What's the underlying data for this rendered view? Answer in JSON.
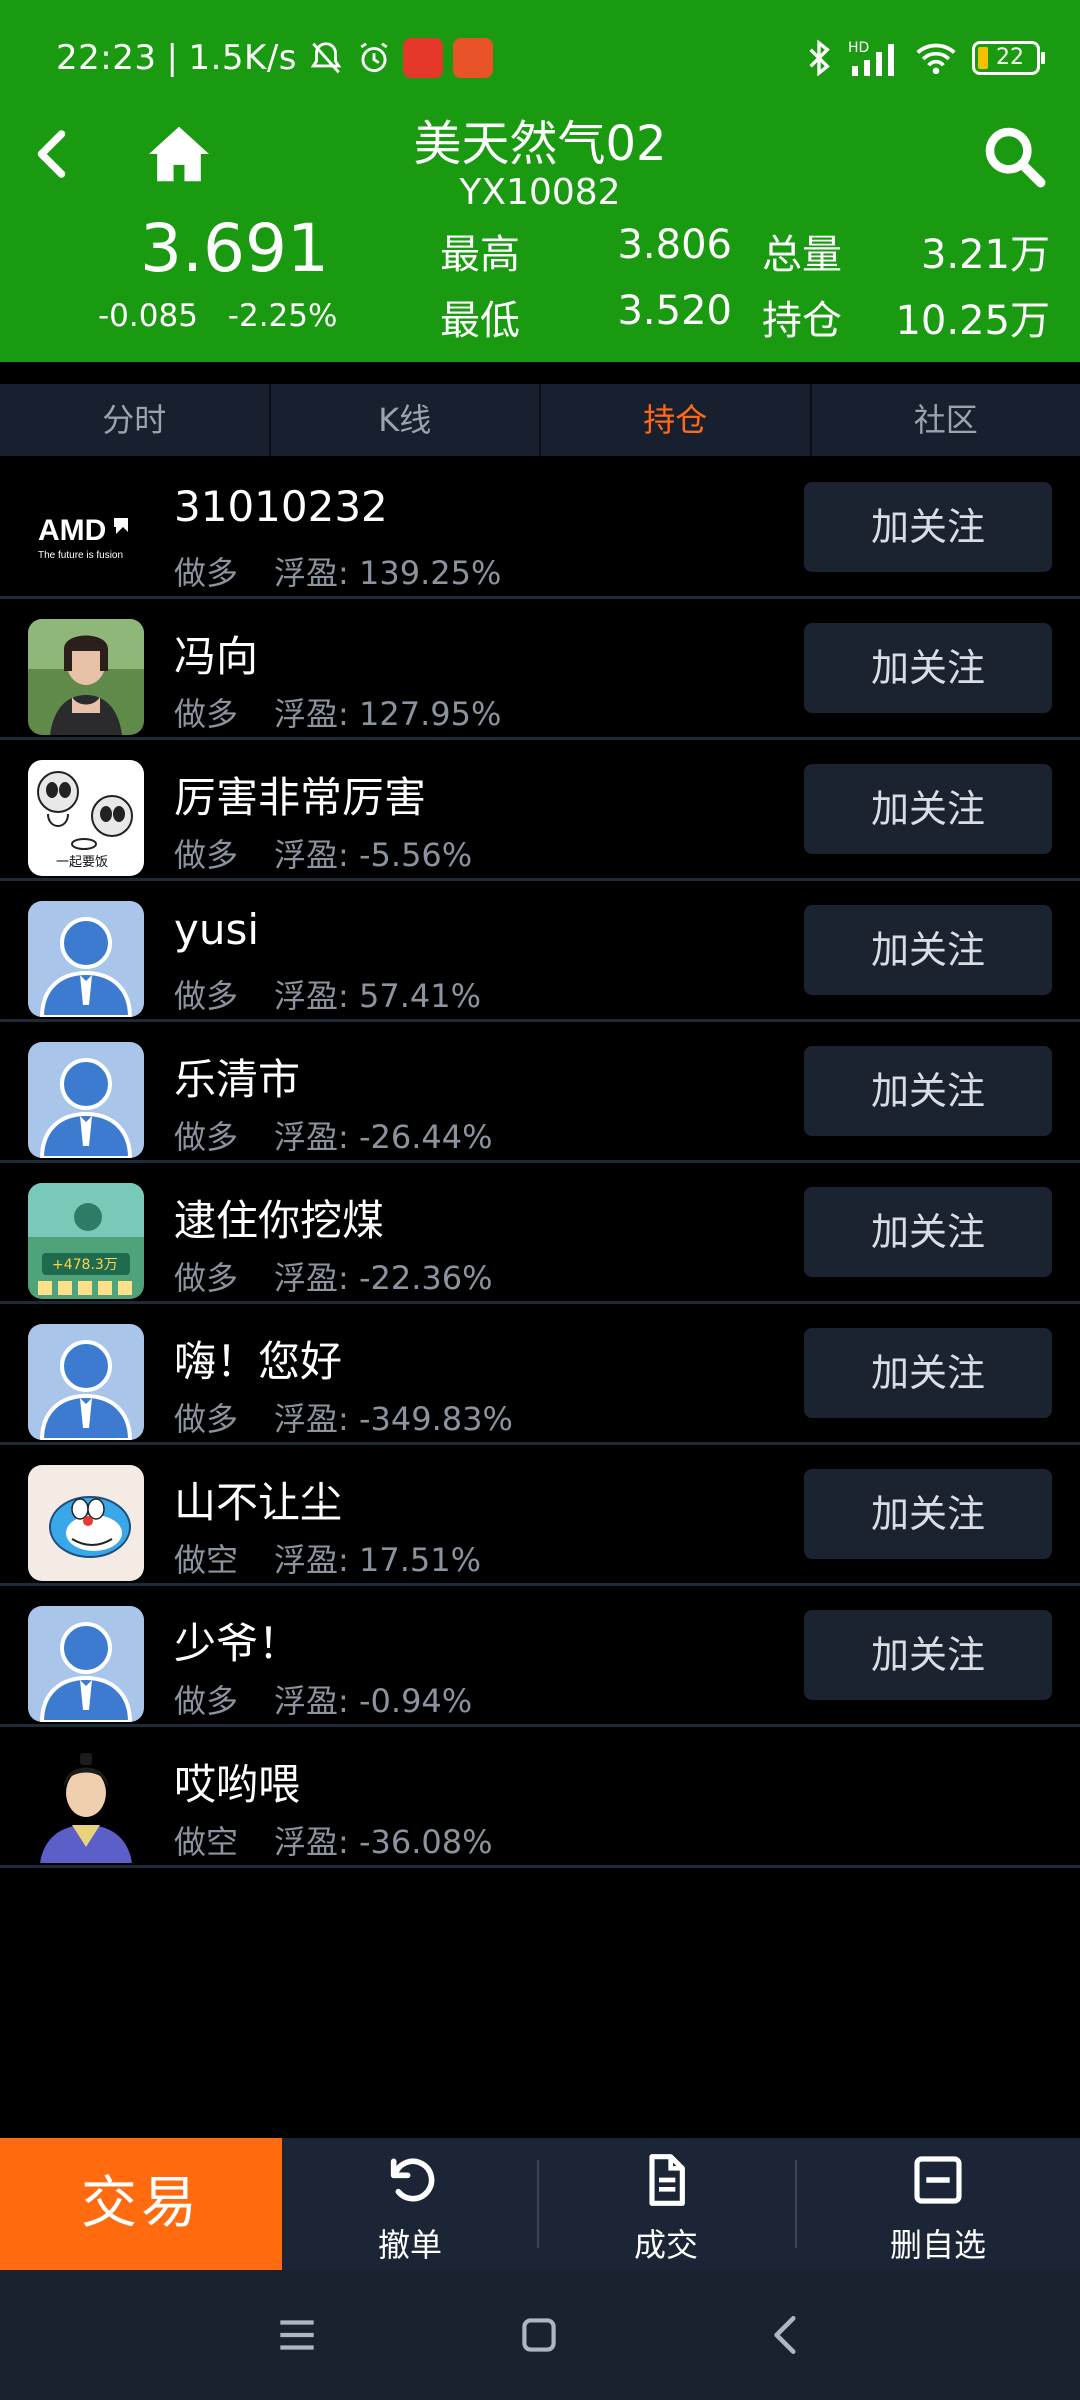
{
  "status": {
    "time": "22:23",
    "speed": "1.5K/s",
    "battery": "22"
  },
  "header": {
    "title": "美天然气02",
    "code": "YX10082",
    "price": "3.691",
    "change": "-0.085",
    "change_pct": "-2.25%",
    "high_label": "最高",
    "high_value": "3.806",
    "low_label": "最低",
    "low_value": "3.520",
    "volume_label": "总量",
    "volume_value": "3.21万",
    "position_label": "持仓",
    "position_value": "10.25万",
    "header_color": "#1a9a10"
  },
  "tabs": [
    {
      "label": "分时",
      "active": false
    },
    {
      "label": "K线",
      "active": false
    },
    {
      "label": "持仓",
      "active": true
    },
    {
      "label": "社区",
      "active": false
    }
  ],
  "accent_color": "#ff6a1a",
  "holders": [
    {
      "name": "31010232",
      "direction": "做多",
      "pnl_label": "浮盈:",
      "pnl": "139.25%",
      "avatar": "amd-logo",
      "follow": "加关注"
    },
    {
      "name": "冯向",
      "direction": "做多",
      "pnl_label": "浮盈:",
      "pnl": "127.95%",
      "avatar": "photo-woman",
      "follow": "加关注"
    },
    {
      "name": "厉害非常厉害",
      "direction": "做多",
      "pnl_label": "浮盈:",
      "pnl": "-5.56%",
      "avatar": "cartoon-meme",
      "follow": "加关注"
    },
    {
      "name": "yusi",
      "direction": "做多",
      "pnl_label": "浮盈:",
      "pnl": "57.41%",
      "avatar": "default-user",
      "follow": "加关注"
    },
    {
      "name": "乐清市",
      "direction": "做多",
      "pnl_label": "浮盈:",
      "pnl": "-26.44%",
      "avatar": "default-user",
      "follow": "加关注"
    },
    {
      "name": "逮住你挖煤",
      "direction": "做多",
      "pnl_label": "浮盈:",
      "pnl": "-22.36%",
      "avatar": "game-screenshot",
      "follow": "加关注"
    },
    {
      "name": "嗨！您好",
      "direction": "做多",
      "pnl_label": "浮盈:",
      "pnl": "-349.83%",
      "avatar": "default-user",
      "follow": "加关注"
    },
    {
      "name": "山不让尘",
      "direction": "做空",
      "pnl_label": "浮盈:",
      "pnl": "17.51%",
      "avatar": "doraemon",
      "follow": "加关注"
    },
    {
      "name": "少爷！",
      "direction": "做多",
      "pnl_label": "浮盈:",
      "pnl": "-0.94%",
      "avatar": "default-user",
      "follow": "加关注"
    },
    {
      "name": "哎哟喂",
      "direction": "做空",
      "pnl_label": "浮盈:",
      "pnl": "-36.08%",
      "avatar": "ancient-character",
      "follow": ""
    }
  ],
  "amd_logo": {
    "brand": "AMD",
    "tagline": "The future is fusion"
  },
  "meme_caption": "一起要饭",
  "game_caption": "+478.3万",
  "actions": {
    "trade": "交易",
    "cancel": "撤单",
    "deals": "成交",
    "remove_watch": "删自选"
  }
}
